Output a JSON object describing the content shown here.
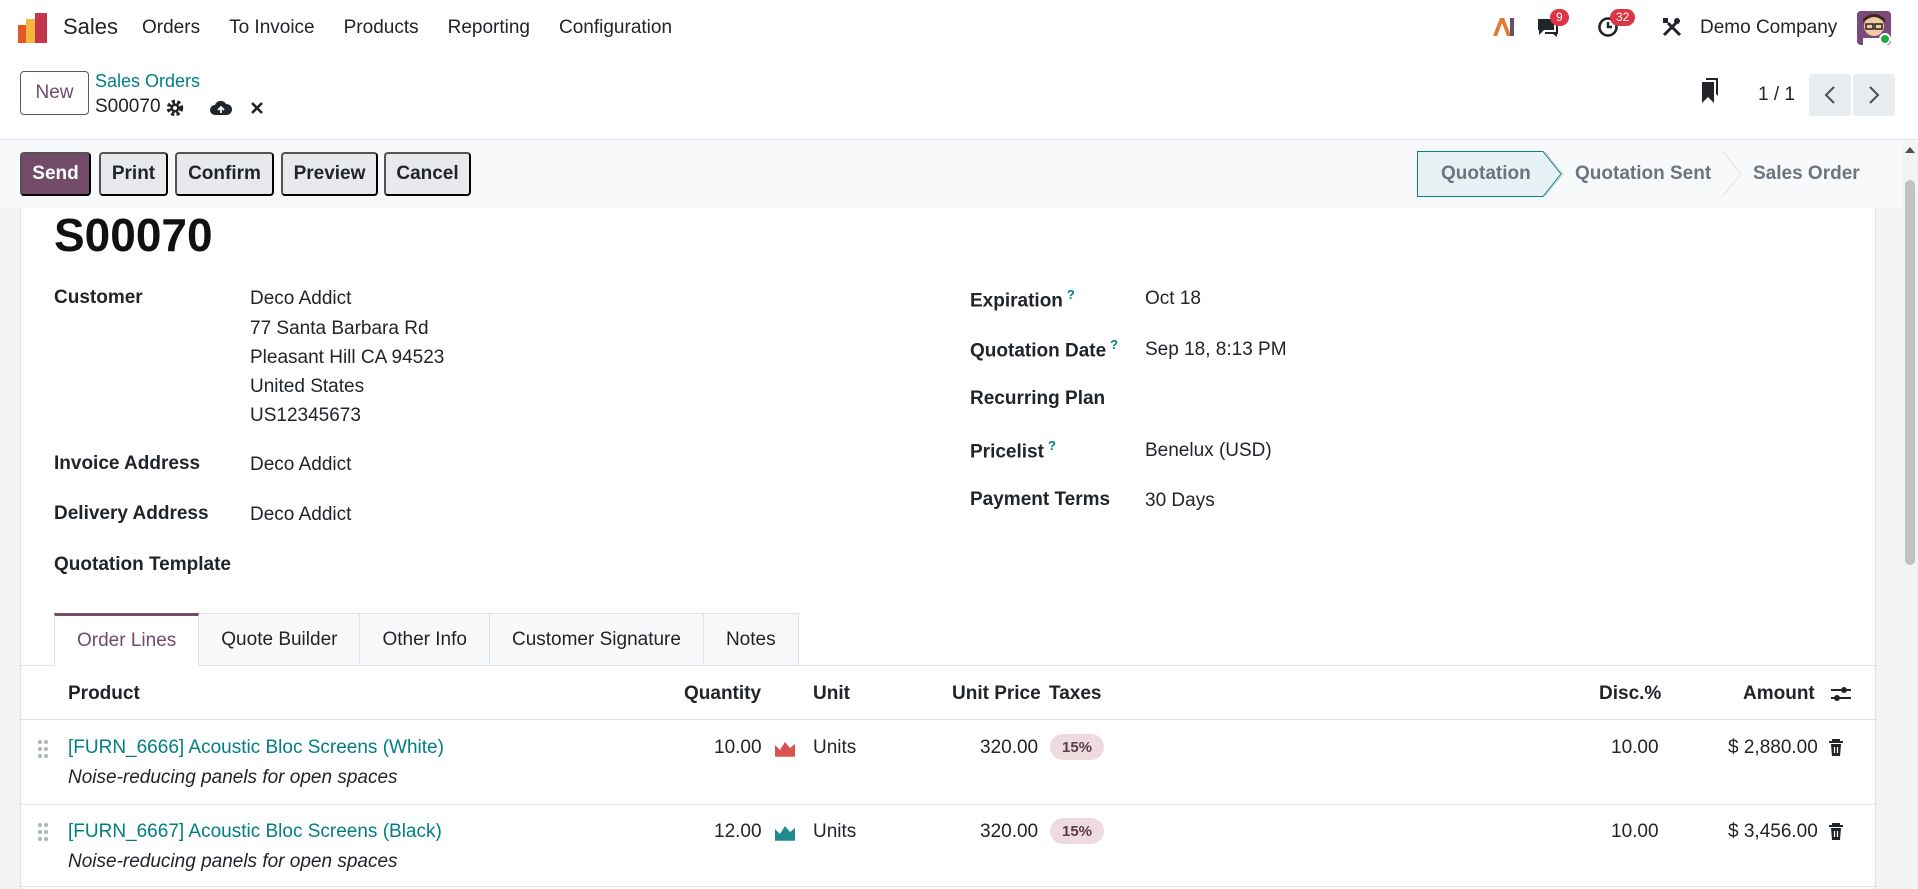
{
  "navbar": {
    "app_name": "Sales",
    "menu": [
      "Orders",
      "To Invoice",
      "Products",
      "Reporting",
      "Configuration"
    ],
    "messages_badge": "9",
    "activities_badge": "32",
    "company": "Demo Company",
    "icons": [
      "sales-app-icon",
      "ai-icon",
      "chat-icon",
      "clock-icon",
      "tools-icon",
      "avatar"
    ]
  },
  "control": {
    "new_label": "New",
    "breadcrumb": "Sales Orders",
    "record_name": "S00070",
    "pager": "1 / 1"
  },
  "actions": {
    "send": "Send",
    "print": "Print",
    "confirm": "Confirm",
    "preview": "Preview",
    "cancel": "Cancel"
  },
  "statusbar": {
    "stages": [
      "Quotation",
      "Quotation Sent",
      "Sales Order"
    ],
    "current": "Quotation"
  },
  "form": {
    "title": "S00070",
    "customer_label": "Customer",
    "customer_lines": [
      "Deco Addict",
      "77 Santa Barbara Rd",
      "Pleasant Hill CA 94523",
      "United States",
      "US12345673"
    ],
    "invoice_address_label": "Invoice Address",
    "invoice_address": "Deco Addict",
    "delivery_address_label": "Delivery Address",
    "delivery_address": "Deco Addict",
    "quotation_template_label": "Quotation Template",
    "expiration_label": "Expiration",
    "expiration": "Oct 18",
    "quotation_date_label": "Quotation Date",
    "quotation_date": "Sep 18, 8:13 PM",
    "recurring_plan_label": "Recurring Plan",
    "pricelist_label": "Pricelist",
    "pricelist": "Benelux (USD)",
    "payment_terms_label": "Payment Terms",
    "payment_terms": "30 Days",
    "help_mark": "?"
  },
  "tabs": [
    "Order Lines",
    "Quote Builder",
    "Other Info",
    "Customer Signature",
    "Notes"
  ],
  "table": {
    "headers": {
      "product": "Product",
      "quantity": "Quantity",
      "unit": "Unit",
      "unit_price": "Unit Price",
      "taxes": "Taxes",
      "disc": "Disc.%",
      "amount": "Amount"
    },
    "rows": [
      {
        "product": "[FURN_6666] Acoustic Bloc Screens (White)",
        "description": "Noise-reducing panels for open spaces",
        "quantity": "10.00",
        "unit": "Units",
        "unit_price": "320.00",
        "tax": "15%",
        "disc": "10.00",
        "amount": "$ 2,880.00",
        "forecast_color": "#d9534f"
      },
      {
        "product": "[FURN_6667] Acoustic Bloc Screens (Black)",
        "description": "Noise-reducing panels for open spaces",
        "quantity": "12.00",
        "unit": "Units",
        "unit_price": "320.00",
        "tax": "15%",
        "disc": "10.00",
        "amount": "$ 3,456.00",
        "forecast_color": "#1f8a8f"
      }
    ]
  },
  "colors": {
    "brand": "#714b67",
    "link": "#017e84",
    "badge": "#dc3545"
  }
}
